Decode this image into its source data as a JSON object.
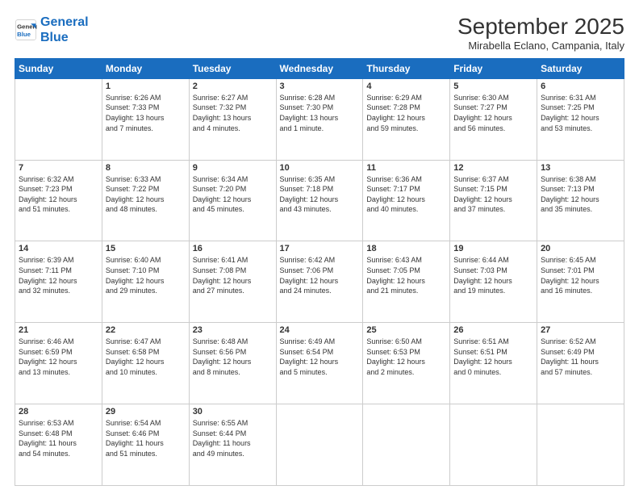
{
  "header": {
    "logo_line1": "General",
    "logo_line2": "Blue",
    "title": "September 2025",
    "subtitle": "Mirabella Eclano, Campania, Italy"
  },
  "days_of_week": [
    "Sunday",
    "Monday",
    "Tuesday",
    "Wednesday",
    "Thursday",
    "Friday",
    "Saturday"
  ],
  "rows": [
    [
      {
        "day": "",
        "text": ""
      },
      {
        "day": "1",
        "text": "Sunrise: 6:26 AM\nSunset: 7:33 PM\nDaylight: 13 hours\nand 7 minutes."
      },
      {
        "day": "2",
        "text": "Sunrise: 6:27 AM\nSunset: 7:32 PM\nDaylight: 13 hours\nand 4 minutes."
      },
      {
        "day": "3",
        "text": "Sunrise: 6:28 AM\nSunset: 7:30 PM\nDaylight: 13 hours\nand 1 minute."
      },
      {
        "day": "4",
        "text": "Sunrise: 6:29 AM\nSunset: 7:28 PM\nDaylight: 12 hours\nand 59 minutes."
      },
      {
        "day": "5",
        "text": "Sunrise: 6:30 AM\nSunset: 7:27 PM\nDaylight: 12 hours\nand 56 minutes."
      },
      {
        "day": "6",
        "text": "Sunrise: 6:31 AM\nSunset: 7:25 PM\nDaylight: 12 hours\nand 53 minutes."
      }
    ],
    [
      {
        "day": "7",
        "text": "Sunrise: 6:32 AM\nSunset: 7:23 PM\nDaylight: 12 hours\nand 51 minutes."
      },
      {
        "day": "8",
        "text": "Sunrise: 6:33 AM\nSunset: 7:22 PM\nDaylight: 12 hours\nand 48 minutes."
      },
      {
        "day": "9",
        "text": "Sunrise: 6:34 AM\nSunset: 7:20 PM\nDaylight: 12 hours\nand 45 minutes."
      },
      {
        "day": "10",
        "text": "Sunrise: 6:35 AM\nSunset: 7:18 PM\nDaylight: 12 hours\nand 43 minutes."
      },
      {
        "day": "11",
        "text": "Sunrise: 6:36 AM\nSunset: 7:17 PM\nDaylight: 12 hours\nand 40 minutes."
      },
      {
        "day": "12",
        "text": "Sunrise: 6:37 AM\nSunset: 7:15 PM\nDaylight: 12 hours\nand 37 minutes."
      },
      {
        "day": "13",
        "text": "Sunrise: 6:38 AM\nSunset: 7:13 PM\nDaylight: 12 hours\nand 35 minutes."
      }
    ],
    [
      {
        "day": "14",
        "text": "Sunrise: 6:39 AM\nSunset: 7:11 PM\nDaylight: 12 hours\nand 32 minutes."
      },
      {
        "day": "15",
        "text": "Sunrise: 6:40 AM\nSunset: 7:10 PM\nDaylight: 12 hours\nand 29 minutes."
      },
      {
        "day": "16",
        "text": "Sunrise: 6:41 AM\nSunset: 7:08 PM\nDaylight: 12 hours\nand 27 minutes."
      },
      {
        "day": "17",
        "text": "Sunrise: 6:42 AM\nSunset: 7:06 PM\nDaylight: 12 hours\nand 24 minutes."
      },
      {
        "day": "18",
        "text": "Sunrise: 6:43 AM\nSunset: 7:05 PM\nDaylight: 12 hours\nand 21 minutes."
      },
      {
        "day": "19",
        "text": "Sunrise: 6:44 AM\nSunset: 7:03 PM\nDaylight: 12 hours\nand 19 minutes."
      },
      {
        "day": "20",
        "text": "Sunrise: 6:45 AM\nSunset: 7:01 PM\nDaylight: 12 hours\nand 16 minutes."
      }
    ],
    [
      {
        "day": "21",
        "text": "Sunrise: 6:46 AM\nSunset: 6:59 PM\nDaylight: 12 hours\nand 13 minutes."
      },
      {
        "day": "22",
        "text": "Sunrise: 6:47 AM\nSunset: 6:58 PM\nDaylight: 12 hours\nand 10 minutes."
      },
      {
        "day": "23",
        "text": "Sunrise: 6:48 AM\nSunset: 6:56 PM\nDaylight: 12 hours\nand 8 minutes."
      },
      {
        "day": "24",
        "text": "Sunrise: 6:49 AM\nSunset: 6:54 PM\nDaylight: 12 hours\nand 5 minutes."
      },
      {
        "day": "25",
        "text": "Sunrise: 6:50 AM\nSunset: 6:53 PM\nDaylight: 12 hours\nand 2 minutes."
      },
      {
        "day": "26",
        "text": "Sunrise: 6:51 AM\nSunset: 6:51 PM\nDaylight: 12 hours\nand 0 minutes."
      },
      {
        "day": "27",
        "text": "Sunrise: 6:52 AM\nSunset: 6:49 PM\nDaylight: 11 hours\nand 57 minutes."
      }
    ],
    [
      {
        "day": "28",
        "text": "Sunrise: 6:53 AM\nSunset: 6:48 PM\nDaylight: 11 hours\nand 54 minutes."
      },
      {
        "day": "29",
        "text": "Sunrise: 6:54 AM\nSunset: 6:46 PM\nDaylight: 11 hours\nand 51 minutes."
      },
      {
        "day": "30",
        "text": "Sunrise: 6:55 AM\nSunset: 6:44 PM\nDaylight: 11 hours\nand 49 minutes."
      },
      {
        "day": "",
        "text": ""
      },
      {
        "day": "",
        "text": ""
      },
      {
        "day": "",
        "text": ""
      },
      {
        "day": "",
        "text": ""
      }
    ]
  ]
}
